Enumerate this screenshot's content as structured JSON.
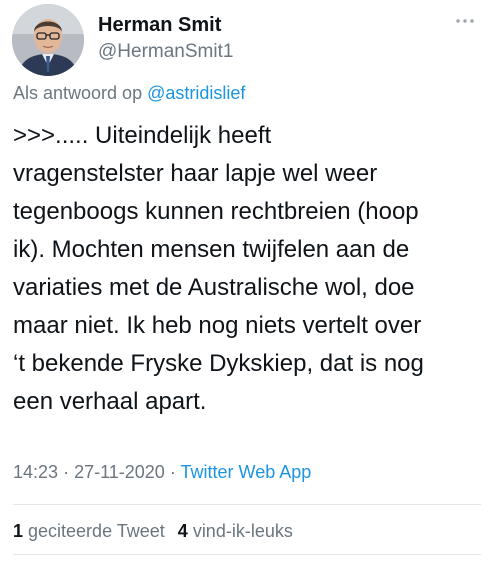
{
  "author": {
    "name": "Herman Smit",
    "handle": "@HermanSmit1",
    "avatar": "profile-photo"
  },
  "reply": {
    "prefix": "Als antwoord op",
    "mention": "@astridislief"
  },
  "tweet": {
    "lines": [
      ">>>..... Uiteindelijk heeft",
      "vragenstelster haar lapje wel weer",
      "tegenboogs kunnen rechtbreien (hoop",
      "ik). Mochten mensen twijfelen aan de",
      "variaties met de Australische wol, doe",
      "maar niet. Ik heb nog niets vertelt over",
      "‘t bekende Fryske Dykskiep, dat is nog",
      "een verhaal apart."
    ]
  },
  "meta": {
    "time": "14:23",
    "separator": "·",
    "date": "27-11-2020",
    "source": "Twitter Web App"
  },
  "stats": {
    "quote_count": "1",
    "quote_label": "geciteerde Tweet",
    "like_count": "4",
    "like_label": "vind-ik-leuks"
  },
  "icons": {
    "more": "more-horizontal-icon"
  },
  "colors": {
    "text": "#0f1419",
    "secondary": "#6b7680",
    "link": "#1b95e0",
    "divider": "#e3e7ea"
  }
}
